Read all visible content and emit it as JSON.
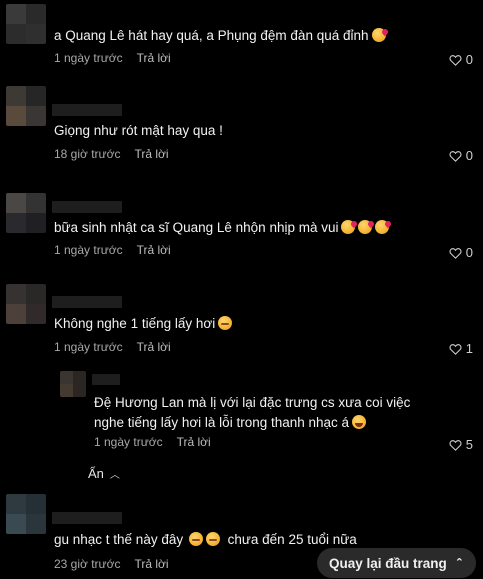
{
  "comments": [
    {
      "text": "a Quang Lê hát hay quá, a Phụng đệm đàn quá đỉnh",
      "time": "1 ngày trước",
      "reply": "Trả lời",
      "likes": "0"
    },
    {
      "text": "Giọng như rót mật hay qua !",
      "time": "18 giờ trước",
      "reply": "Trả lời",
      "likes": "0"
    },
    {
      "text": "bữa sinh nhật ca sĩ Quang Lê nhộn nhịp mà vui",
      "time": "1 ngày trước",
      "reply": "Trả lời",
      "likes": "0"
    },
    {
      "text": "Không nghe 1 tiếng lấy hơi",
      "time": "1 ngày trước",
      "reply": "Trả lời",
      "likes": "1"
    },
    {
      "text": "gu nhạc t thế này đây",
      "text_after": "chưa đến 25 tuổi nữa",
      "time": "23 giờ trước",
      "reply": "Trả lời"
    }
  ],
  "reply_thread": {
    "text": "Đệ Hương Lan mà lị với lại đặc trưng cs xưa coi việc nghe tiếng lấy hơi là lỗi trong thanh nhạc á",
    "time": "1 ngày trước",
    "reply": "Trả lời",
    "likes": "5",
    "hide_label": "Ẩn"
  },
  "back_to_top": {
    "label": "Quay lại đầu trang"
  },
  "icons": {
    "like": "heart-outline-icon",
    "hide": "chevron-up-icon",
    "back_to_top": "double-chevron-up-icon"
  }
}
